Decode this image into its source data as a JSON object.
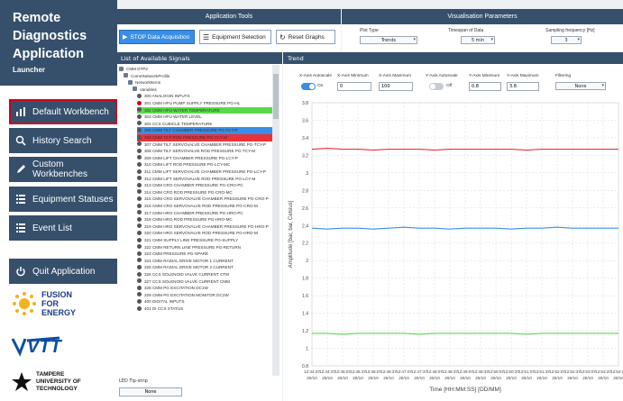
{
  "brand": {
    "line1": "Remote",
    "line2": "Diagnostics",
    "line3": "Application",
    "sub": "Launcher"
  },
  "nav": [
    {
      "label": "Default Workbench",
      "icon": "bar-chart-icon",
      "active": true
    },
    {
      "label": "History Search",
      "icon": "search-icon",
      "active": false
    },
    {
      "label": "Custom Workbenches",
      "icon": "pencil-icon",
      "active": false
    },
    {
      "label": "Equipment Statuses",
      "icon": "list-icon",
      "active": false
    },
    {
      "label": "Event List",
      "icon": "list-icon",
      "active": false
    },
    {
      "label": "Quit Application",
      "icon": "power-icon",
      "active": false
    }
  ],
  "logos": {
    "fusion1": "FUSION",
    "fusion2": "FOR",
    "fusion3": "ENERGY",
    "vtt": "VTT",
    "tut1": "TAMPERE",
    "tut2": "UNIVERSITY OF",
    "tut3": "TECHNOLOGY"
  },
  "header": {
    "tools": "Application Tools",
    "vis": "Visualisation Parameters"
  },
  "tools": {
    "stop": "STOP Data Acquisition",
    "equip": "Equipment Selection",
    "reset": "Reset Graphs"
  },
  "vis": {
    "plot_type_label": "Plot Type",
    "plot_type": "Trends",
    "timespan_label": "Timespan of Data",
    "timespan": "5 min",
    "freq_label": "Sampling frequency [Hz]",
    "freq": "3"
  },
  "signals": {
    "title": "List of Available Signals",
    "rows": [
      {
        "text": "CMM DTP2",
        "indent": 0,
        "color": "",
        "bullet": "box"
      },
      {
        "text": "CommNetworkProfile",
        "indent": 1,
        "color": "",
        "bullet": "box"
      },
      {
        "text": "NetworkItems",
        "indent": 2,
        "color": "",
        "bullet": "box"
      },
      {
        "text": "Variables",
        "indent": 3,
        "color": "",
        "bullet": "box"
      },
      {
        "text": "300 ANALOGIN INPUTS",
        "indent": 4,
        "color": "",
        "bullet": "dot"
      },
      {
        "text": "301 CMM HPU PUMP SUPPLY PRESSURE PG-HL",
        "indent": 4,
        "color": "",
        "bullet": "red"
      },
      {
        "text": "302 CMM HPU WATER TEMPERATURE",
        "indent": 4,
        "color": "#59d94a",
        "bullet": "dot"
      },
      {
        "text": "303 CMM HPU WATER LEVEL",
        "indent": 4,
        "color": "",
        "bullet": "dot"
      },
      {
        "text": "304 CCS CUBICLE TEMPERATURE",
        "indent": 4,
        "color": "",
        "bullet": "dot"
      },
      {
        "text": "305 CMM TILT CHAMBER PRESSURE PG-TCY-P",
        "indent": 4,
        "color": "#3a8ee6",
        "bullet": "dot"
      },
      {
        "text": "306 CMM TILT ROD PRESSURE PG-TCY-M",
        "indent": 4,
        "color": "#e8333a",
        "bullet": "dot"
      },
      {
        "text": "307 CMM TILT SERVOVALVE CHAMBER PRESSURE PG-TCY-P",
        "indent": 4,
        "color": "",
        "bullet": "dot"
      },
      {
        "text": "308 CMM TILT SERVOVALVE ROD PRESSURE PG-TCY-M",
        "indent": 4,
        "color": "",
        "bullet": "dot"
      },
      {
        "text": "309 CMM LIFT CHAMBER PRESSURE PG-LCY-P",
        "indent": 4,
        "color": "",
        "bullet": "dot"
      },
      {
        "text": "310 CMM LIFT ROD PRESSURE PG-LCY-MC",
        "indent": 4,
        "color": "",
        "bullet": "dot"
      },
      {
        "text": "311 CMM LIFT SERVOVALVE CHAMBER PRESSURE PG-LCY-P",
        "indent": 4,
        "color": "",
        "bullet": "dot"
      },
      {
        "text": "312 CMM LIFT SERVOVALVE ROD PRESSURE PG-LCY-M",
        "indent": 4,
        "color": "",
        "bullet": "dot"
      },
      {
        "text": "313 CMM CRO CHAMBER PRESSURE PG-CRO-PC",
        "indent": 4,
        "color": "",
        "bullet": "dot"
      },
      {
        "text": "314 CMM CRO ROD PRESSURE PG-CRO-MC",
        "indent": 4,
        "color": "",
        "bullet": "dot"
      },
      {
        "text": "315 CMM CRO SERVOVALVE CHAMBER PRESSURE PG-CRO-P",
        "indent": 4,
        "color": "",
        "bullet": "dot"
      },
      {
        "text": "316 CMM CRO SERVOVALVE ROD PRESSURE PG-CRO-M",
        "indent": 4,
        "color": "",
        "bullet": "dot"
      },
      {
        "text": "317 CMM HRO CHAMBER PRESSURE PG-HRO-PC",
        "indent": 4,
        "color": "",
        "bullet": "dot"
      },
      {
        "text": "318 CMM HRO ROD PRESSURE PG-HRO-MC",
        "indent": 4,
        "color": "",
        "bullet": "dot"
      },
      {
        "text": "319 CMM HRO SERVOVALVE CHAMBER PRESSURE PG-HRO-P",
        "indent": 4,
        "color": "",
        "bullet": "dot"
      },
      {
        "text": "320 CMM HRO SERVOVALVE ROD PRESSURE PG-HRO-M",
        "indent": 4,
        "color": "",
        "bullet": "dot"
      },
      {
        "text": "321 CMM SUPPLY LINE PRESSURE PG-SUPPLY",
        "indent": 4,
        "color": "",
        "bullet": "dot"
      },
      {
        "text": "322 CMM RETURN LINE PRESSURE PG-RETURN",
        "indent": 4,
        "color": "",
        "bullet": "dot"
      },
      {
        "text": "323 CMM PRESSURE PG-SPARE",
        "indent": 4,
        "color": "",
        "bullet": "dot"
      },
      {
        "text": "324 CMM RADIAL DRIVE MOTOR 1 CURRENT",
        "indent": 4,
        "color": "",
        "bullet": "dot"
      },
      {
        "text": "325 CMM RADIAL DRIVE MOTOR 2 CURRENT",
        "indent": 4,
        "color": "",
        "bullet": "dot"
      },
      {
        "text": "326 CCS SOLENOID VALVE CURRENT CTM",
        "indent": 4,
        "color": "",
        "bullet": "dot"
      },
      {
        "text": "327 CCS SOLENOID VALVE CURRENT CMM",
        "indent": 4,
        "color": "",
        "bullet": "dot"
      },
      {
        "text": "328 CMM PG EXCITATION DC1W",
        "indent": 4,
        "color": "",
        "bullet": "dot"
      },
      {
        "text": "329 CMM PG EXCITATION MONITOR DC1W",
        "indent": 4,
        "color": "",
        "bullet": "dot"
      },
      {
        "text": "400 DIGITAL INPUTS",
        "indent": 4,
        "color": "",
        "bullet": "dot"
      },
      {
        "text": "401 DI CCS STATUS",
        "indent": 4,
        "color": "",
        "bullet": "dot"
      }
    ],
    "led_label": "LED Tip-strip",
    "led_value": "None"
  },
  "trend": {
    "title": "Trend",
    "x_auto_label": "X-Axis Autoscale",
    "x_auto_state": "On",
    "x_min_label": "X-Axis Minimum",
    "x_min": "0",
    "x_max_label": "X-Axis Maximum",
    "x_max": "100",
    "y_auto_label": "Y-Axis Autoscale",
    "y_auto_state": "Off",
    "y_min_label": "Y-Axis Minimum",
    "y_min": "0.8",
    "y_max_label": "Y-Axis Maximum",
    "y_max": "3.8",
    "filter_label": "Filtering",
    "filter": "None"
  },
  "chart_data": {
    "type": "line",
    "xlabel": "Time [HH:MM:SS] [DD/MM]",
    "ylabel": "Amplitude [bar, bar, Celsius]",
    "ylim": [
      0.8,
      3.8
    ],
    "yticks": [
      "0.8",
      "1",
      "1.2",
      "1.4",
      "1.6",
      "1.8",
      "2",
      "2.2",
      "2.4",
      "2.6",
      "2.8",
      "3",
      "3.2",
      "3.4",
      "3.6",
      "3.8"
    ],
    "xticks": [
      [
        "12:44:07",
        "20/10"
      ],
      [
        "12:44:37",
        "20/10"
      ],
      [
        "12:45:07",
        "20/10"
      ],
      [
        "12:45:37",
        "20/10"
      ],
      [
        "12:46:07",
        "20/10"
      ],
      [
        "12:46:37",
        "20/10"
      ],
      [
        "12:47:07",
        "20/10"
      ],
      [
        "12:47:37",
        "20/10"
      ],
      [
        "12:48:07",
        "20/10"
      ],
      [
        "12:48:37",
        "20/10"
      ],
      [
        "12:49:07",
        "20/10"
      ],
      [
        "12:49:37",
        "20/10"
      ],
      [
        "12:50:07",
        "20/10"
      ],
      [
        "12:50:37",
        "20/10"
      ],
      [
        "12:51:07",
        "20/10"
      ],
      [
        "12:51:37",
        "20/10"
      ],
      [
        "12:52:07",
        "20/10"
      ],
      [
        "12:52:37",
        "20/10"
      ],
      [
        "12:53:07",
        "20/10"
      ],
      [
        "12:53:37",
        "20/10"
      ],
      [
        "12:54:07",
        "20/10"
      ]
    ],
    "grid": true,
    "series": [
      {
        "color": "#e8333a",
        "values": [
          3.27,
          3.28,
          3.27,
          3.27,
          3.26,
          3.27,
          3.27,
          3.27,
          3.26,
          3.27,
          3.27,
          3.27,
          3.27,
          3.27,
          3.26,
          3.27,
          3.27,
          3.27,
          3.27,
          3.27,
          3.27
        ]
      },
      {
        "color": "#3a8ee6",
        "values": [
          2.37,
          2.36,
          2.37,
          2.37,
          2.36,
          2.37,
          2.38,
          2.37,
          2.37,
          2.36,
          2.37,
          2.37,
          2.37,
          2.36,
          2.37,
          2.37,
          2.38,
          2.37,
          2.37,
          2.37,
          2.37
        ]
      },
      {
        "color": "#59d94a",
        "values": [
          1.17,
          1.17,
          1.16,
          1.17,
          1.17,
          1.17,
          1.17,
          1.16,
          1.17,
          1.17,
          1.17,
          1.17,
          1.17,
          1.17,
          1.16,
          1.17,
          1.17,
          1.17,
          1.17,
          1.17,
          1.17
        ]
      }
    ]
  }
}
